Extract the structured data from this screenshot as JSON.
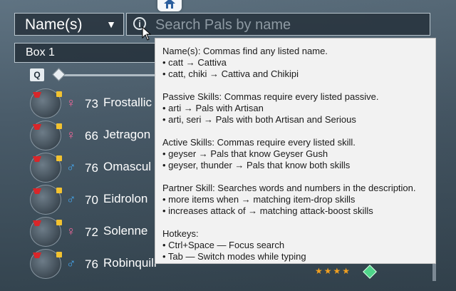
{
  "mode_select": {
    "value": "Name(s)",
    "caret": "▼"
  },
  "search": {
    "placeholder": "Search Pals by name",
    "info_glyph": "i"
  },
  "box_select": {
    "value": "Box 1"
  },
  "hotkey_hint": "Q",
  "pals": [
    {
      "gender": "♀",
      "gender_class": "f",
      "level": "73",
      "name": "Frostallic"
    },
    {
      "gender": "♀",
      "gender_class": "f",
      "level": "66",
      "name": "Jetragon"
    },
    {
      "gender": "♂",
      "gender_class": "m",
      "level": "76",
      "name": "Omascul"
    },
    {
      "gender": "♂",
      "gender_class": "m",
      "level": "70",
      "name": "Eidrolon"
    },
    {
      "gender": "♀",
      "gender_class": "f",
      "level": "72",
      "name": "Solenne"
    },
    {
      "gender": "♂",
      "gender_class": "m",
      "level": "76",
      "name": "Robinquill"
    }
  ],
  "rank_stars": "★★★★",
  "tooltip": {
    "sections": [
      {
        "lines": [
          "Name(s): Commas find any listed name.",
          "• catt → Cattiva",
          "• catt, chiki → Cattiva and Chikipi"
        ]
      },
      {
        "lines": [
          "Passive Skills: Commas require every listed passive.",
          "• arti → Pals with Artisan",
          "• arti, seri → Pals with both Artisan and Serious"
        ]
      },
      {
        "lines": [
          "Active Skills: Commas require every listed skill.",
          "• geyser → Pals that know Geyser Gush",
          "• geyser, thunder → Pals that know both skills"
        ]
      },
      {
        "lines": [
          "Partner Skill: Searches words and numbers in the description.",
          "• more items when → matching item-drop skills",
          "• increases attack of → matching attack-boost skills"
        ]
      },
      {
        "lines": [
          "Hotkeys:",
          "• Ctrl+Space — Focus search",
          "• Tab — Switch modes while typing"
        ]
      }
    ]
  },
  "colors": {
    "female": "#f0679a",
    "male": "#45a7f0",
    "tooltip_bg": "#f2f2f2"
  }
}
